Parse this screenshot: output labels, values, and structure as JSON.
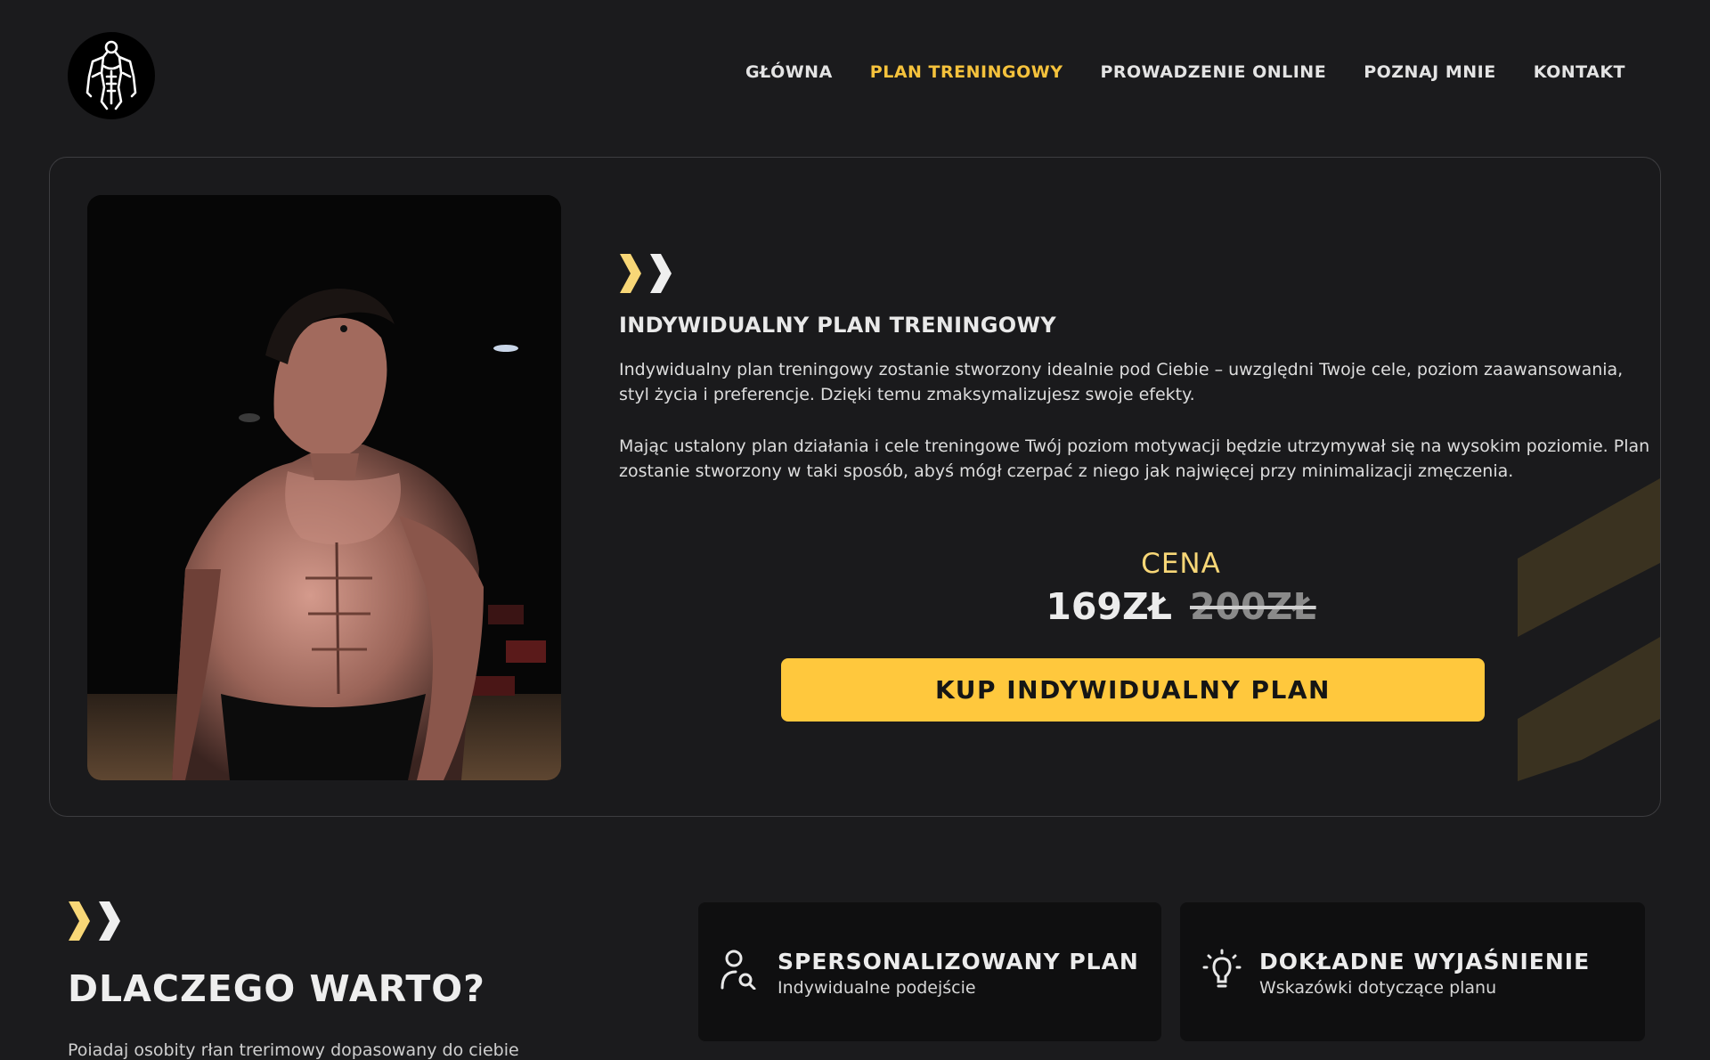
{
  "nav": {
    "items": [
      {
        "label": "GŁÓWNA"
      },
      {
        "label": "PLAN TRENINGOWY",
        "active": true
      },
      {
        "label": "PROWADZENIE ONLINE"
      },
      {
        "label": "POZNAJ MNIE"
      },
      {
        "label": "KONTAKT"
      }
    ]
  },
  "product": {
    "title": "INDYWIDUALNY PLAN TRENINGOWY",
    "paragraph1": "Indywidualny plan treningowy zostanie stworzony idealnie pod Ciebie – uwzględni Twoje cele, poziom zaawansowania, styl życia i preferencje. Dzięki temu zmaksymalizujesz swoje efekty.",
    "paragraph2": "Mając ustalony plan działania i cele treningowe Twój poziom motywacji będzie utrzymywał się na wysokim poziomie. Plan zostanie stworzony w taki sposób, abyś mógł czerpać z niego jak najwięcej przy minimalizacji zmęczenia.",
    "price_label": "CENA",
    "price_new": "169ZŁ",
    "price_old": "200ZŁ",
    "buy_button": "KUP INDYWIDUALNY PLAN"
  },
  "why": {
    "title": "DLACZEGO WARTO?",
    "text": "Poiadaj osobity rłan trerimowy dopasowany do ciebie"
  },
  "features": [
    {
      "icon": "user-search-icon",
      "title": "SPERSONALIZOWANY PLAN",
      "subtitle": "Indywidualne podejście"
    },
    {
      "icon": "lightbulb-icon",
      "title": "DOKŁADNE WYJAŚNIENIE",
      "subtitle": "Wskazówki dotyczące planu"
    }
  ],
  "colors": {
    "background": "#1b1b1d",
    "accent": "#ffc83d",
    "active_nav": "#f5c23c",
    "card_border": "#3d3d40"
  }
}
